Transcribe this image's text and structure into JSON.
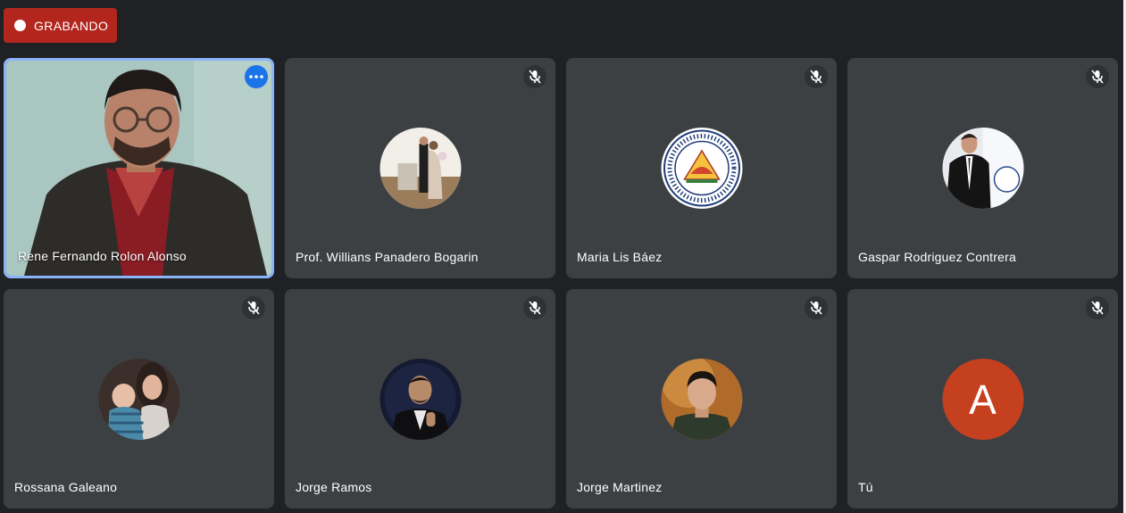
{
  "recording": {
    "label": "GRABANDO"
  },
  "participants": [
    {
      "name": "Rene Fernando Rolon Alonso",
      "icon": "more-options-icon",
      "speaking": true
    },
    {
      "name": "Prof. Willians Panadero Bogarin",
      "icon": "mic-off-icon"
    },
    {
      "name": "Maria Lis Báez",
      "icon": "mic-off-icon"
    },
    {
      "name": "Gaspar Rodriguez Contrera",
      "icon": "mic-off-icon"
    },
    {
      "name": "Rossana Galeano",
      "icon": "mic-off-icon"
    },
    {
      "name": "Jorge Ramos",
      "icon": "mic-off-icon"
    },
    {
      "name": "Jorge Martinez",
      "icon": "mic-off-icon"
    },
    {
      "name": "Tú",
      "icon": "mic-off-icon",
      "avatar_letter": "A"
    }
  ],
  "colors": {
    "background": "#202124",
    "tile": "#3c4043",
    "recording": "#b3261e",
    "active_border": "#8ab4f8",
    "letter_avatar": "#c5401f"
  }
}
